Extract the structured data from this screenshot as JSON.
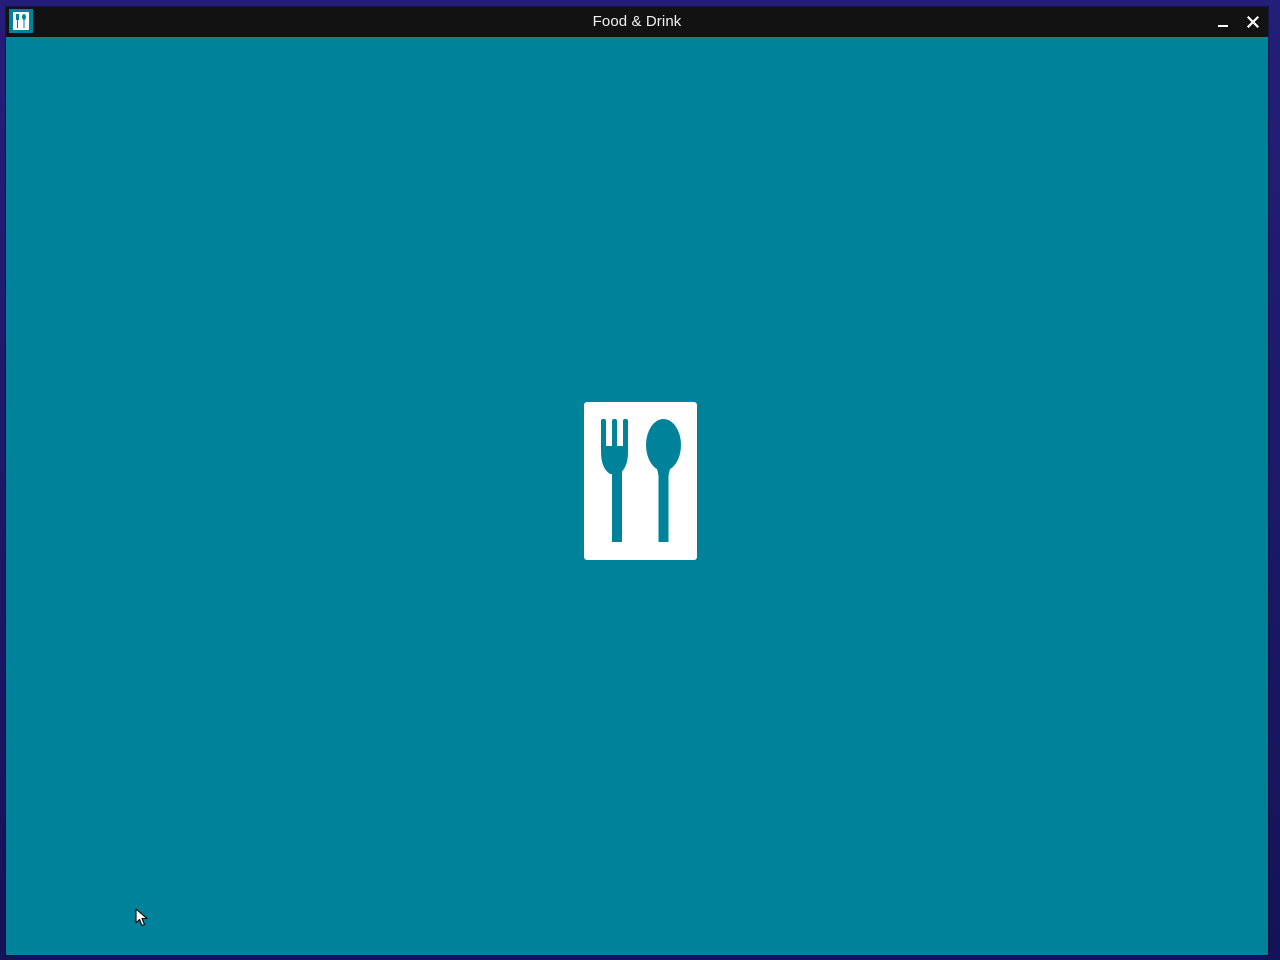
{
  "window": {
    "title": "Food & Drink",
    "app_icon": "fork-spoon-icon",
    "controls": {
      "minimize_icon": "minimize-icon",
      "close_icon": "close-icon"
    }
  },
  "splash": {
    "icon": "fork-spoon-icon"
  },
  "colors": {
    "accent": "#00839a",
    "titlebar": "#121212",
    "desktop": "#1d1b6b",
    "splash_tile": "#ffffff"
  }
}
